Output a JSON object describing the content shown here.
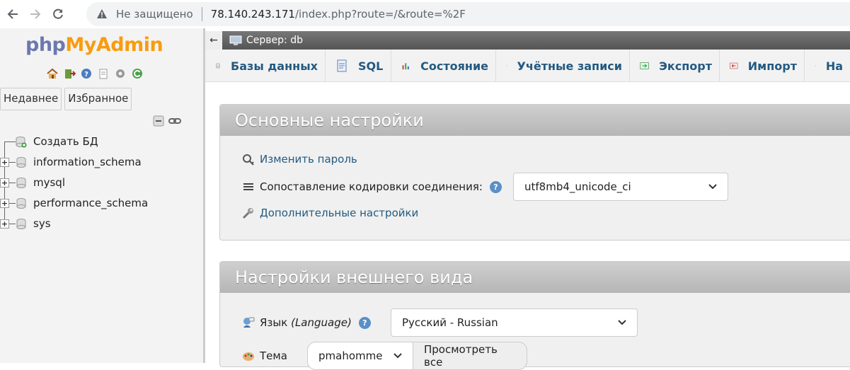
{
  "browser": {
    "security_label": "Не защищено",
    "url_host": "78.140.243.171",
    "url_path": "/index.php?route=/&route=%2F"
  },
  "logo": {
    "php": "php",
    "my": "My",
    "admin": "Admin"
  },
  "leftnav": {
    "tabs": [
      "Недавнее",
      "Избранное"
    ],
    "tree": [
      {
        "label": "Создать БД",
        "type": "new"
      },
      {
        "label": "information_schema",
        "type": "db"
      },
      {
        "label": "mysql",
        "type": "db"
      },
      {
        "label": "performance_schema",
        "type": "db"
      },
      {
        "label": "sys",
        "type": "db"
      }
    ]
  },
  "serverbar": {
    "collapse": "←",
    "label": "Сервер: db"
  },
  "topmenu": {
    "items": [
      {
        "label": "Базы данных",
        "icon": "database-icon"
      },
      {
        "label": "SQL",
        "icon": "sql-icon"
      },
      {
        "label": "Состояние",
        "icon": "status-icon"
      },
      {
        "label": "Учётные записи",
        "icon": "users-icon"
      },
      {
        "label": "Экспорт",
        "icon": "export-icon"
      },
      {
        "label": "Импорт",
        "icon": "import-icon"
      },
      {
        "label": "На",
        "icon": "settings-icon"
      }
    ]
  },
  "general_settings": {
    "title": "Основные настройки",
    "change_password": "Изменить пароль",
    "collation_label": "Сопоставление кодировки соединения:",
    "collation_value": "utf8mb4_unicode_ci",
    "more_settings": "Дополнительные настройки"
  },
  "appearance_settings": {
    "title": "Настройки внешнего вида",
    "language_label": "Язык",
    "language_label_en": "(Language)",
    "language_value": "Русский - Russian",
    "theme_label": "Тема",
    "theme_value": "pmahomme",
    "view_all": "Просмотреть все"
  },
  "colors": {
    "link": "#235a81",
    "logo_blue": "#6c78af",
    "logo_orange": "#f89c0e"
  }
}
